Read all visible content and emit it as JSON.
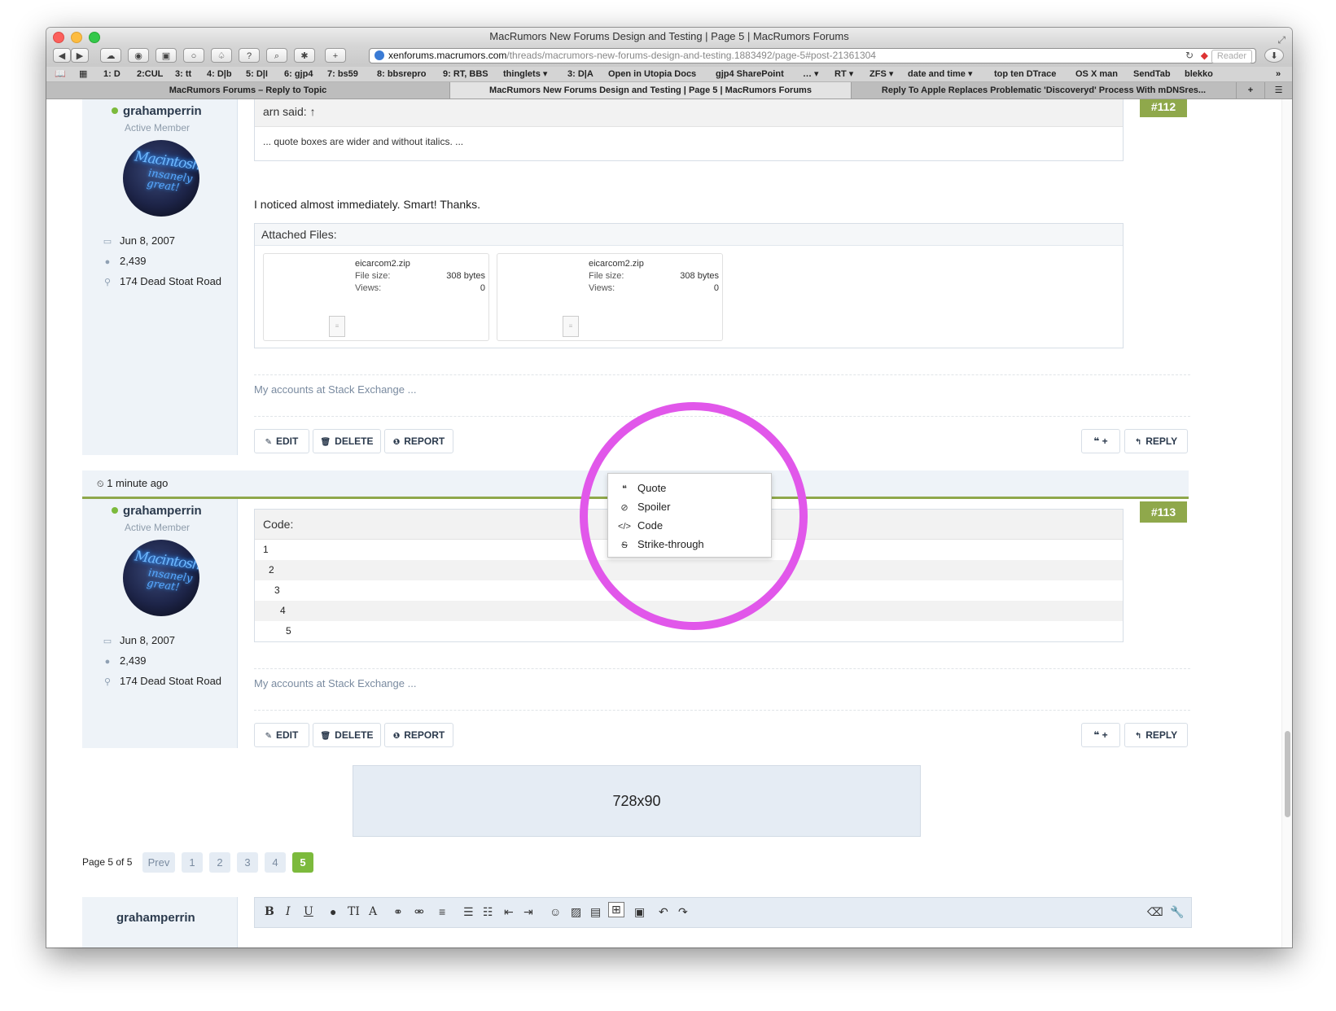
{
  "window": {
    "title": "MacRumors New Forums Design and Testing | Page 5 | MacRumors Forums"
  },
  "toolbar": {
    "url_host": "xenforums.macrumors.com",
    "url_path": "/threads/macrumors-new-forums-design-and-testing.1883492/page-5#post-21361304",
    "reader_label": "Reader"
  },
  "bookmarks": [
    "1: D",
    "2:CUL",
    "3: tt",
    "4: D|b",
    "5: D|I",
    "6: gjp4",
    "7: bs59",
    "8: bbsrepro",
    "9: RT, BBS",
    "thinglets ▾",
    "3: D|A",
    "Open in Utopia Docs",
    "gjp4 SharePoint",
    "… ▾",
    "RT ▾",
    "ZFS ▾",
    "date and time ▾",
    "top ten DTrace",
    "OS X man",
    "SendTab",
    "blekko"
  ],
  "tabs": [
    "MacRumors Forums – Reply to Topic",
    "MacRumors New Forums Design and Testing | Page 5 | MacRumors Forums",
    "Reply To Apple Replaces Problematic 'Discoveryd' Process With mDNSres..."
  ],
  "post112": {
    "number": "#112",
    "user": "grahamperrin",
    "user_title": "Active Member",
    "joined": "Jun 8, 2007",
    "messages": "2,439",
    "location": "174 Dead Stoat Road",
    "quote_author": "arn said: ↑",
    "quote_text": "... quote boxes are wider and without italics. ...",
    "message": "I noticed almost immediately. Smart! Thanks.",
    "attachments_label": "Attached Files:",
    "files": [
      {
        "name": "eicarcom2.zip",
        "size_label": "File size:",
        "size": "308 bytes",
        "views_label": "Views:",
        "views": "0"
      },
      {
        "name": "eicarcom2.zip",
        "size_label": "File size:",
        "size": "308 bytes",
        "views_label": "Views:",
        "views": "0"
      }
    ],
    "signature": "My accounts at Stack Exchange ..."
  },
  "actions": {
    "edit": "EDIT",
    "delete": "DELETE",
    "report": "REPORT",
    "multiquote": "❝ +",
    "reply": "REPLY"
  },
  "timebar": {
    "time": "1 minute ago"
  },
  "post113": {
    "number": "#113",
    "user": "grahamperrin",
    "user_title": "Active Member",
    "joined": "Jun 8, 2007",
    "messages": "2,439",
    "location": "174 Dead Stoat Road",
    "code_label": "Code:",
    "code_lines": [
      "1",
      "2",
      "3",
      "4",
      "5"
    ],
    "signature": "My accounts at Stack Exchange ..."
  },
  "popup_menu": {
    "items": [
      "Quote",
      "Spoiler",
      "Code",
      "Strike-through"
    ]
  },
  "ad": {
    "label": "728x90"
  },
  "pagination": {
    "label": "Page 5 of 5",
    "prev": "Prev",
    "pages": [
      "1",
      "2",
      "3",
      "4",
      "5"
    ],
    "current": "5"
  },
  "reply_box": {
    "user": "grahamperrin"
  },
  "colors": {
    "accent_green": "#8fa84b",
    "online_green": "#7cba3c",
    "highlight_ring": "#e157ea",
    "panel_blue": "#eef3f8"
  }
}
